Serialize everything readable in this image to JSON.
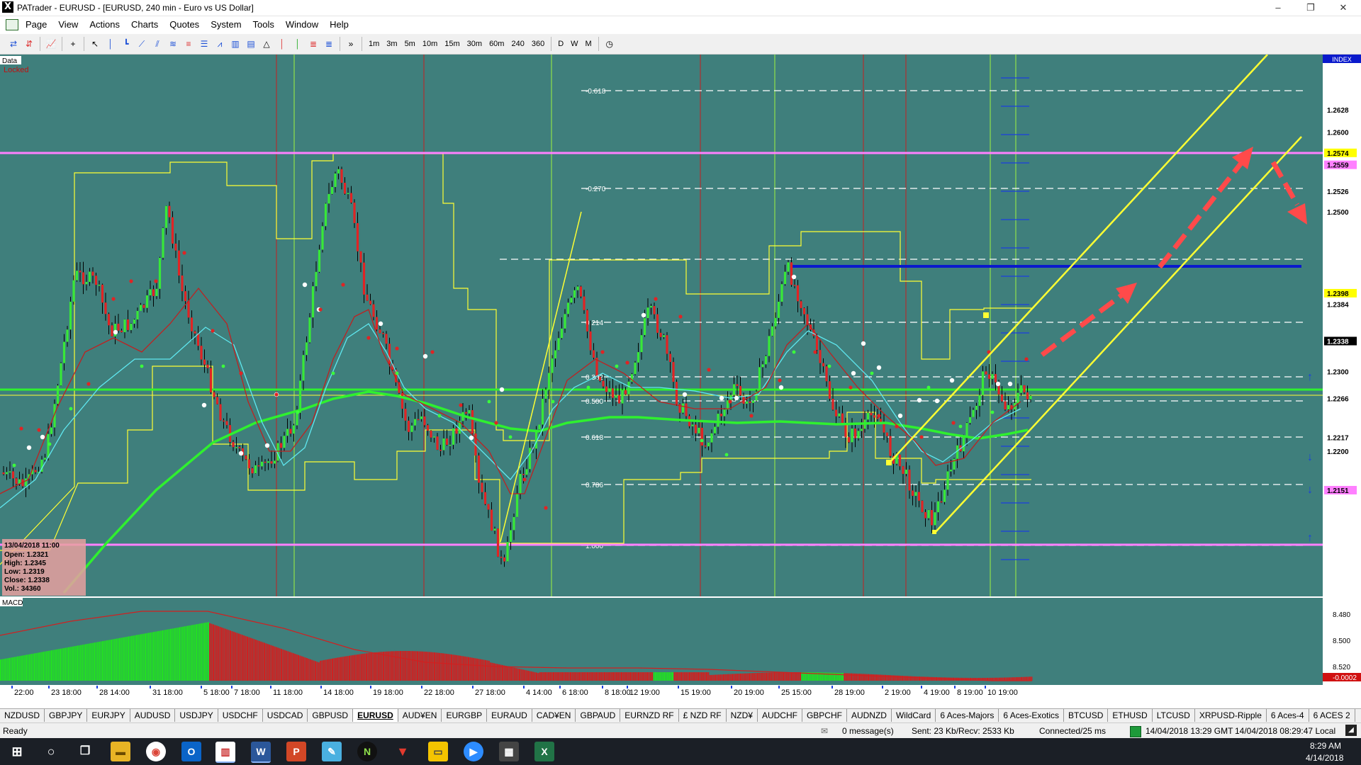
{
  "window": {
    "title": "PATrader - EURUSD - [EURUSD, 240 min - Euro vs US Dollar]",
    "min": "–",
    "max": "❐",
    "close": "✕"
  },
  "menu": [
    "Page",
    "View",
    "Actions",
    "Charts",
    "Quotes",
    "System",
    "Tools",
    "Window",
    "Help"
  ],
  "mdi_buttons": [
    "–",
    "❐",
    "✕"
  ],
  "toolbar": {
    "timeframes": [
      "1m",
      "3m",
      "5m",
      "10m",
      "15m",
      "30m",
      "60m",
      "240",
      "360"
    ],
    "periods": [
      "D",
      "W",
      "M"
    ],
    "more": "»"
  },
  "chart": {
    "data_label": "Data",
    "locked_label": "Locked",
    "index_label": "INDEX",
    "macd_label": "MACD",
    "fib_labels": [
      "-0.618",
      "-0.270",
      "0.214",
      "0.382",
      "0.500",
      "0.618",
      "0.786",
      "1.000"
    ],
    "price_ticks": [
      "1.2628",
      "1.2600",
      "1.2574",
      "1.2559",
      "1.2526",
      "1.2500",
      "1.2398",
      "1.2384",
      "1.2338",
      "1.2300",
      "1.2266",
      "1.2217",
      "1.2200",
      "1.2151"
    ],
    "macd_ticks": [
      "8.480",
      "8.500",
      "8.520",
      "-0.0002"
    ],
    "time_labels": [
      "22:00",
      "23 18:00",
      "28 14:00",
      "31 18:00",
      "5 18:00",
      "7 18:00",
      "11 18:00",
      "14 18:00",
      "19 18:00",
      "22 18:00",
      "27 18:00",
      "4 14:00",
      "6 18:00",
      "8 18:00",
      "12 19:00",
      "15 19:00",
      "20 19:00",
      "25 15:00",
      "28 19:00",
      "2 19:00",
      "4 19:00",
      "8 19:00",
      "10 19:00"
    ],
    "ohlc": {
      "date": "13/04/2018 11:00",
      "open": "Open: 1.2321",
      "high": "High: 1.2345",
      "low": "Low: 1.2319",
      "close": "Close: 1.2338",
      "vol": "Vol.: 34360"
    },
    "colors": {
      "bg": "#3f7f7c",
      "up": "#38e838",
      "down": "#e02424",
      "channel": "#ffff33",
      "magenta": "#ff80ff",
      "blue": "#0a1acc",
      "arrows": "#ff4a4a"
    }
  },
  "symbols": [
    "NZDUSD",
    "GBPJPY",
    "EURJPY",
    "AUDUSD",
    "USDJPY",
    "USDCHF",
    "USDCAD",
    "GBPUSD",
    "EURUSD",
    "AUD¥EN",
    "EURGBP",
    "EURAUD",
    "CAD¥EN",
    "GBPAUD",
    "EURNZD RF",
    "£ NZD RF",
    "NZD¥",
    "AUDCHF",
    "GBPCHF",
    "AUDNZD",
    "WildCard",
    "6 Aces-Majors",
    "6 Aces-Exotics",
    "BTCUSD",
    "ETHUSD",
    "LTCUSD",
    "XRPUSD-Ripple",
    "6 Aces-4",
    "6 ACES 2"
  ],
  "active_symbol": "EURUSD",
  "status": {
    "ready": "Ready",
    "messages": "0 message(s)",
    "traffic": "Sent: 23 Kb/Recv: 2533 Kb",
    "connection": "Connected/25 ms",
    "gmt": "14/04/2018 13:29 GMT",
    "local": "14/04/2018 08:29:47 Local"
  },
  "taskbar": {
    "time": "8:29 AM",
    "date": "4/14/2018"
  }
}
